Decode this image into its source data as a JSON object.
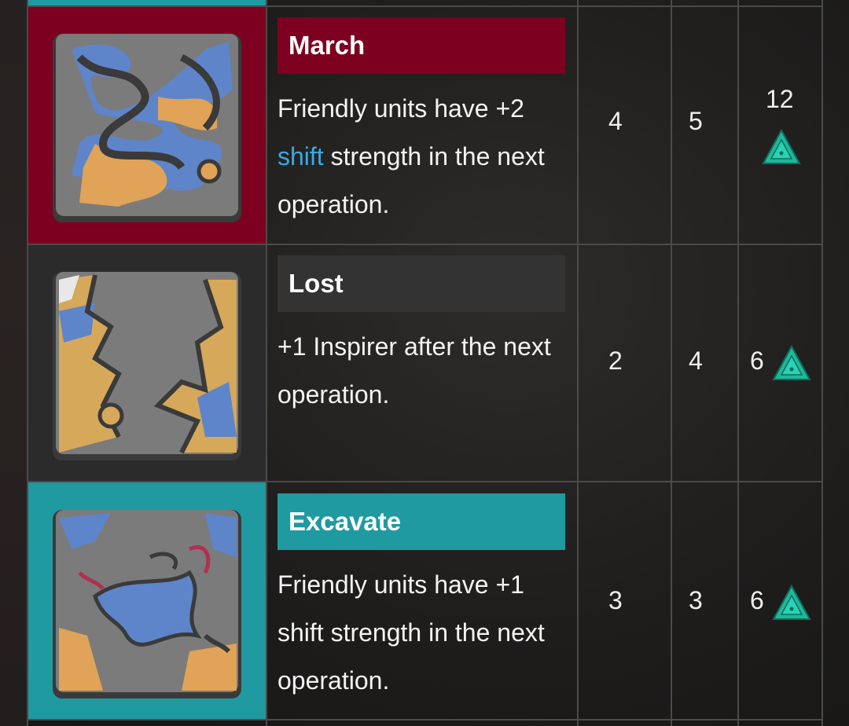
{
  "rows": [
    {
      "name": "March",
      "title_color": "#7d0020",
      "tile_bg": "#7d0020",
      "desc_pre": "Friendly units have +2",
      "desc_link": "shift",
      "desc_post": " strength in the next operation.",
      "col1": "4",
      "col2": "5",
      "col3": "12",
      "cost_icon": "triangle-crystal-icon"
    },
    {
      "name": "Lost",
      "title_color": "#333333",
      "tile_bg": "#2b2b2b",
      "desc": "+1 Inspirer after the next operation.",
      "col1": "2",
      "col2": "4",
      "col3": "6",
      "cost_icon": "triangle-crystal-icon"
    },
    {
      "name": "Excavate",
      "title_color": "#1f9aa0",
      "tile_bg": "#1f9aa0",
      "desc": "Friendly units have +1 shift strength in the next operation.",
      "col1": "3",
      "col2": "3",
      "col3": "6",
      "cost_icon": "triangle-crystal-icon"
    }
  ]
}
